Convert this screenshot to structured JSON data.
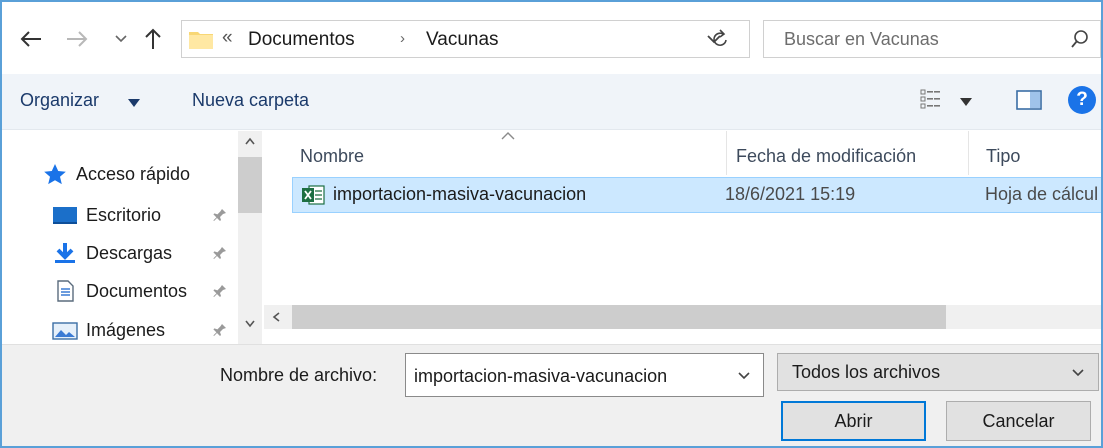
{
  "address_bar": {
    "overflow_chevron": "«",
    "breadcrumbs": [
      "Documentos",
      "Vacunas"
    ],
    "separator": "›"
  },
  "search": {
    "placeholder": "Buscar en Vacunas"
  },
  "toolbar": {
    "organize_label": "Organizar",
    "new_folder_label": "Nueva carpeta",
    "help_label": "?"
  },
  "nav_pane": {
    "items": [
      {
        "label": "Acceso rápido",
        "icon": "star-icon",
        "pinned": false
      },
      {
        "label": "Escritorio",
        "icon": "desktop-icon",
        "pinned": true
      },
      {
        "label": "Descargas",
        "icon": "download-icon",
        "pinned": true
      },
      {
        "label": "Documentos",
        "icon": "document-icon",
        "pinned": true
      },
      {
        "label": "Imágenes",
        "icon": "pictures-icon",
        "pinned": true
      }
    ]
  },
  "file_list": {
    "columns": [
      "Nombre",
      "Fecha de modificación",
      "Tipo"
    ],
    "rows": [
      {
        "name": "importacion-masiva-vacunacion",
        "modified": "18/6/2021 15:19",
        "type": "Hoja de cálcul",
        "icon": "excel-file-icon",
        "selected": true
      }
    ]
  },
  "footer": {
    "filename_label": "Nombre de archivo:",
    "filename_value": "importacion-masiva-vacunacion",
    "filetype_selected": "Todos los archivos",
    "open_label": "Abrir",
    "cancel_label": "Cancelar"
  },
  "colors": {
    "accent": "#0078d7",
    "selection": "#cce8ff",
    "toolbar_bg": "#f0f4f9",
    "excel_green": "#1d6f42"
  }
}
